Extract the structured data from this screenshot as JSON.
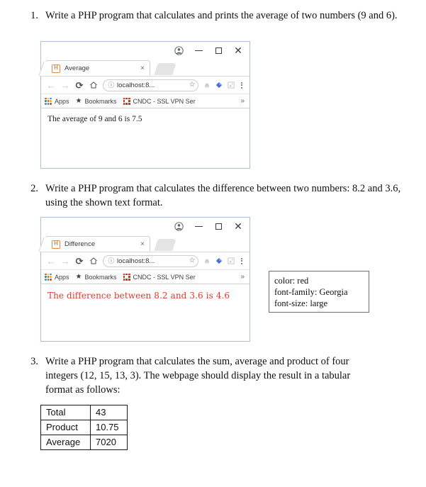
{
  "questions": [
    {
      "number": "1.",
      "text": "Write a PHP program that calculates and prints the average of two numbers (9 and 6)."
    },
    {
      "number": "2.",
      "text": "Write a PHP program that calculates the difference between two numbers: 8.2 and 3.6, using the shown text format."
    },
    {
      "number": "3.",
      "text": "Write a PHP program that calculates the sum, average and product of four integers (12, 15, 13, 3). The webpage should display the result in a tabular format as follows:"
    }
  ],
  "browsers": [
    {
      "tab_title": "Average",
      "tab_close_glyph": "×",
      "back_glyph": "←",
      "forward_glyph": "→",
      "reload_glyph": "⟳",
      "info_glyph": "ⓘ",
      "url": "localhost:8...",
      "star_glyph": "☆",
      "minimize_glyph": "",
      "maximize_glyph": "",
      "close_glyph": "✕",
      "bookmarks": {
        "apps_label": "Apps",
        "bookmarks_label": "Bookmarks",
        "vpn_label": "CNDC - SSL VPN Ser",
        "overflow_glyph": "»"
      },
      "content_text": "The average of 9 and 6 is 7.5",
      "content_color": "#1a1a1a"
    },
    {
      "tab_title": "Difference",
      "tab_close_glyph": "×",
      "back_glyph": "←",
      "forward_glyph": "→",
      "reload_glyph": "⟳",
      "info_glyph": "ⓘ",
      "url": "localhost:8...",
      "star_glyph": "☆",
      "minimize_glyph": "",
      "maximize_glyph": "",
      "close_glyph": "✕",
      "bookmarks": {
        "apps_label": "Apps",
        "bookmarks_label": "Bookmarks",
        "vpn_label": "CNDC - SSL VPN Ser",
        "overflow_glyph": "»"
      },
      "content_text": "The difference between 8.2 and 3.6 is 4.6",
      "content_color": "#e0382a"
    }
  ],
  "css_box": {
    "line1": "color: red",
    "line2": "font-family: Georgia",
    "line3": "font-size: large"
  },
  "result_table": {
    "rows": [
      {
        "label": "Total",
        "value": "43"
      },
      {
        "label": "Product",
        "value": "10.75"
      },
      {
        "label": "Average",
        "value": "7020"
      }
    ]
  },
  "colors": {
    "browser_border": "#a9c2d8",
    "favicon_orange": "#e8883a",
    "red_text": "#e0382a",
    "vpn_red": "#d93025",
    "extension_blue": "#4a6fd4"
  }
}
